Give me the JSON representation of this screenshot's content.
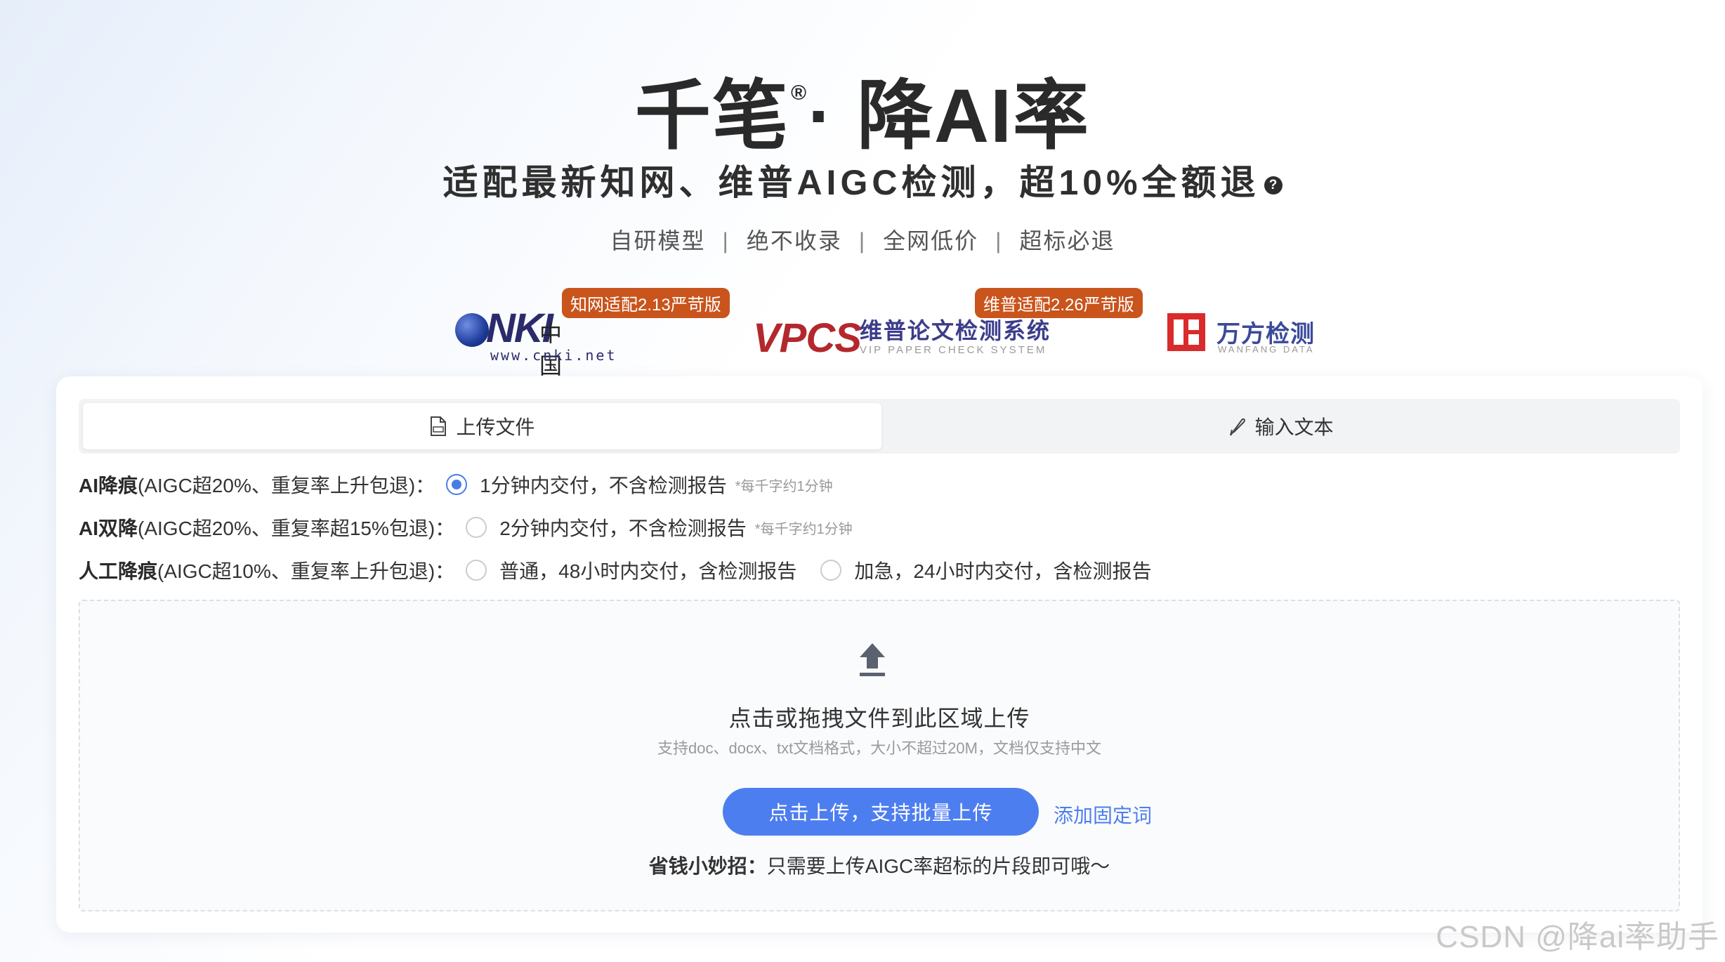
{
  "hero": {
    "title_left": "千笔",
    "registered_mark": "®",
    "title_right": "· 降AI率",
    "subtitle": "适配最新知网、维普AIGC检测，超10%全额退",
    "help_glyph": "?",
    "features": [
      "自研模型",
      "绝不收录",
      "全网低价",
      "超标必退"
    ],
    "feature_separator": "|"
  },
  "logos": {
    "cnki": {
      "badge": "知网适配2.13严苛版",
      "mark": "NKI",
      "cn_name": "中国知网",
      "url": "www.cnki.net"
    },
    "vpcs": {
      "badge": "维普适配2.26严苛版",
      "mark": "VPCS",
      "cn_name": "维普论文检测系统",
      "en_name": "VIP PAPER CHECK SYSTEM"
    },
    "wanfang": {
      "cn_name": "万方检测",
      "en_name": "WANFANG DATA"
    }
  },
  "tabs": {
    "upload_label": "上传文件",
    "input_label": "输入文本",
    "active": "upload"
  },
  "options": {
    "ai_reduce": {
      "name": "AI降痕",
      "desc": "(AIGC超20%、重复率上升包退)：",
      "choice": "1分钟内交付，不含检测报告",
      "note": "*每千字约1分钟",
      "selected": true
    },
    "ai_double": {
      "name": "AI双降",
      "desc": "(AIGC超20%、重复率超15%包退)：",
      "choice": "2分钟内交付，不含检测报告",
      "note": "*每千字约1分钟",
      "selected": false
    },
    "manual": {
      "name": "人工降痕",
      "desc": "(AIGC超10%、重复率上升包退)：",
      "choice_normal": "普通，48小时内交付，含检测报告",
      "choice_urgent": "加急，24小时内交付，含检测报告",
      "selected": false
    }
  },
  "dropzone": {
    "title": "点击或拖拽文件到此区域上传",
    "hint": "支持doc、docx、txt文档格式，大小不超过20M，文档仅支持中文",
    "upload_button": "点击上传，支持批量上传",
    "fixed_words_link": "添加固定词",
    "tip_label": "省钱小妙招：",
    "tip_text": "只需要上传AIGC率超标的片段即可哦～"
  },
  "watermark": "CSDN @降ai率助手",
  "colors": {
    "accent": "#4d7ef0",
    "badge": "#c9541c",
    "vpcs_red": "#b3282d",
    "wanfang_red": "#d92b2b"
  }
}
